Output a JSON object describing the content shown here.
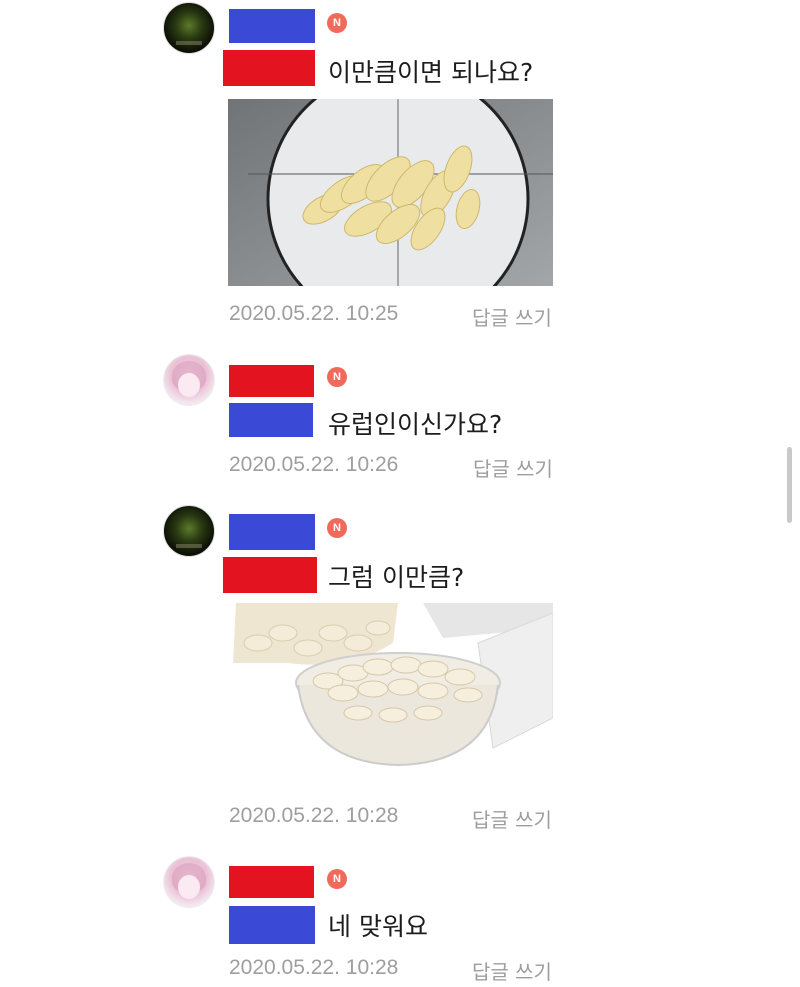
{
  "comments": [
    {
      "text": "이만큼이면 되나요?",
      "timestamp": "2020.05.22. 10:25",
      "reply_label": "답글 쓰기",
      "badge": "N",
      "avatar": "dark-avatar",
      "has_image": true
    },
    {
      "text": "유럽인이신가요?",
      "timestamp": "2020.05.22. 10:26",
      "reply_label": "답글 쓰기",
      "badge": "N",
      "avatar": "pink-avatar",
      "has_image": false
    },
    {
      "text": "그럼 이만큼?",
      "timestamp": "2020.05.22. 10:28",
      "reply_label": "답글 쓰기",
      "badge": "N",
      "avatar": "dark-avatar",
      "has_image": true
    },
    {
      "text": "네 맞워요",
      "timestamp": "2020.05.22. 10:28",
      "reply_label": "답글 쓰기",
      "badge": "N",
      "avatar": "pink-avatar",
      "has_image": false
    }
  ],
  "colors": {
    "redaction_blue": "#3a49d6",
    "redaction_red": "#e3141f",
    "new_badge": "#f06a5b",
    "meta_text": "#9e9e9e"
  }
}
